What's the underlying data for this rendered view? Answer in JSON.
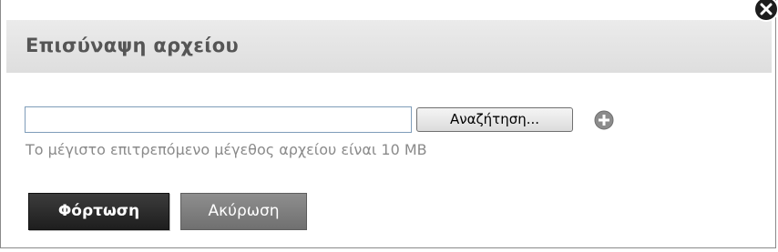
{
  "dialog": {
    "title": "Επισύναψη αρχείου",
    "close_icon": "close-icon"
  },
  "file_input": {
    "value": "",
    "placeholder": ""
  },
  "browse_button": {
    "label": "Αναζήτηση..."
  },
  "add_icon": "plus-circle-icon",
  "size_hint": "Το μέγιστο επιτρεπόμενο μέγεθος αρχείου είναι 10 MB",
  "actions": {
    "upload_label": "Φόρτωση",
    "cancel_label": "Ακύρωση"
  },
  "colors": {
    "header_bg": "#e4e4e4",
    "title_text": "#555555",
    "upload_bg": "#2a2a2a",
    "cancel_bg": "#7f7f7f",
    "hint_text": "#8a8a8a"
  }
}
